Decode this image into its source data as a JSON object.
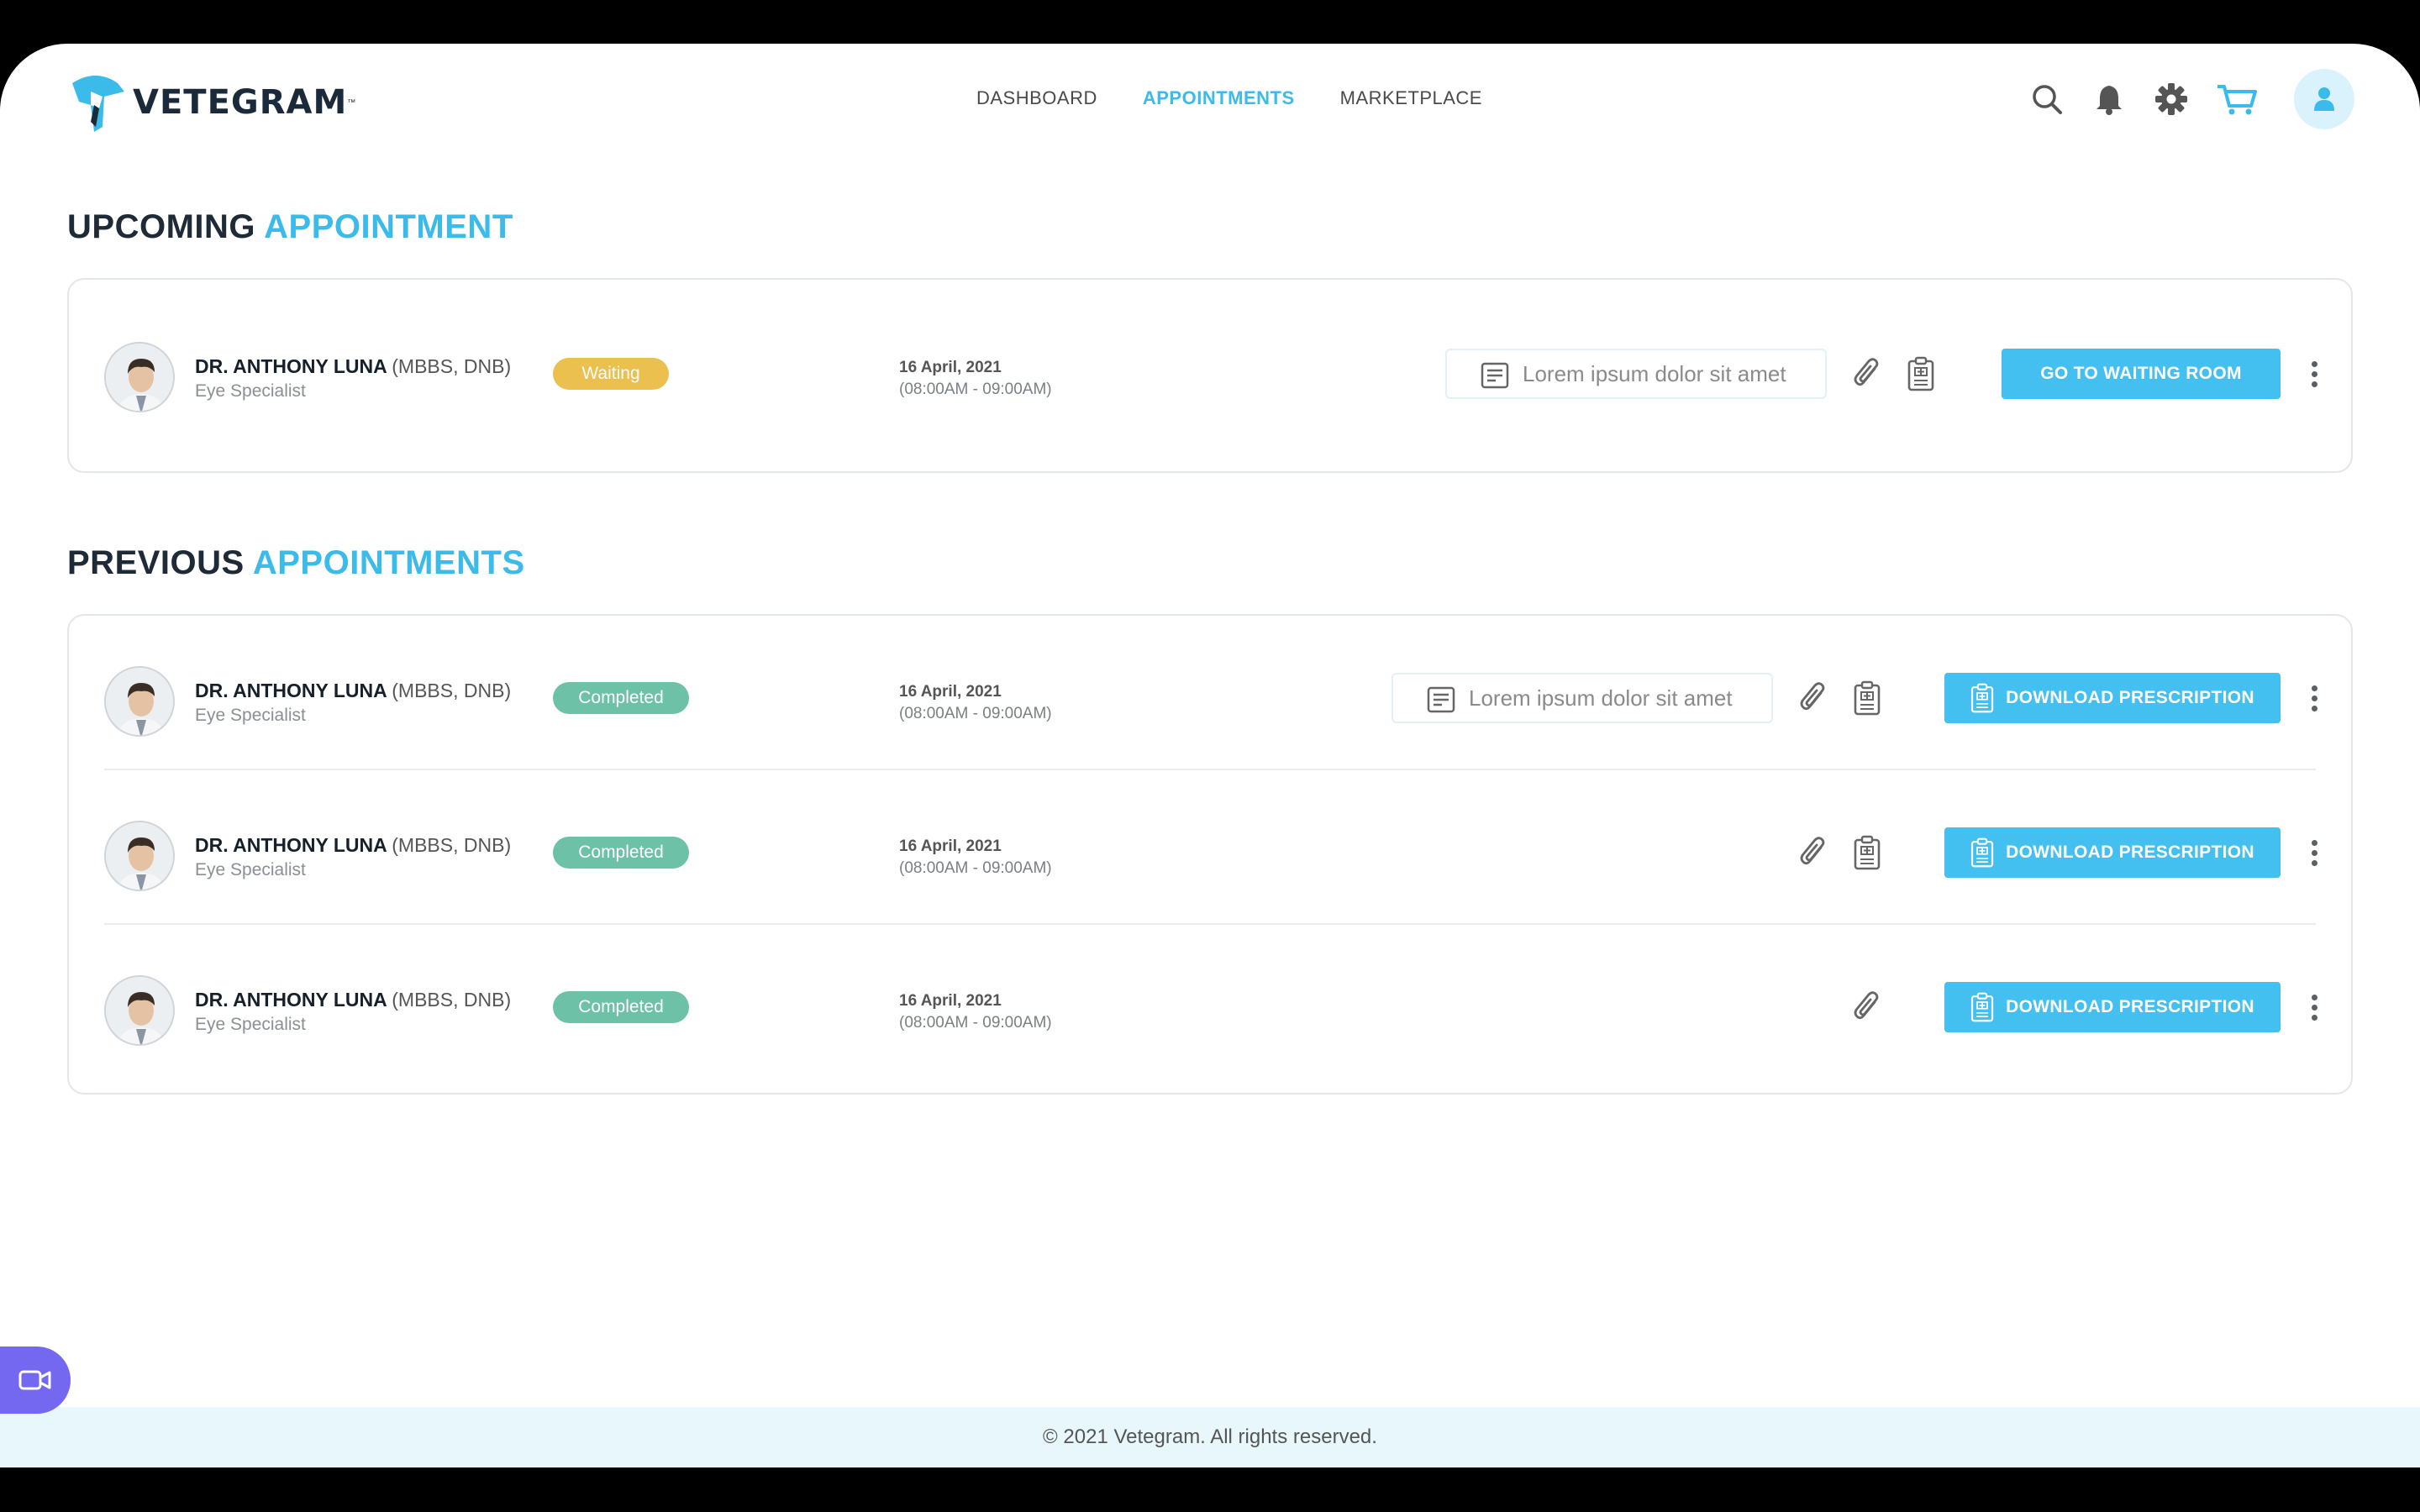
{
  "app": {
    "name": "VETEGRAM",
    "tm": "™"
  },
  "nav": [
    {
      "label": "DASHBOARD",
      "active": false
    },
    {
      "label": "APPOINTMENTS",
      "active": true
    },
    {
      "label": "MARKETPLACE",
      "active": false
    }
  ],
  "header_icons": [
    "search-icon",
    "bell-icon",
    "gear-icon",
    "cart-icon",
    "user-icon"
  ],
  "upcoming": {
    "title_plain": "UPCOMING ",
    "title_highlight": "APPOINTMENT",
    "items": [
      {
        "doctor": "DR. ANTHONY LUNA",
        "quals": "(MBBS, DNB)",
        "specialty": "Eye Specialist",
        "status": "Waiting",
        "date": "16 April, 2021",
        "time": "(08:00AM - 09:00AM)",
        "note": "Lorem ipsum dolor sit amet",
        "action": "GO TO WAITING ROOM"
      }
    ]
  },
  "previous": {
    "title_plain": "PREVIOUS ",
    "title_highlight": "APPOINTMENTS",
    "items": [
      {
        "doctor": "DR. ANTHONY LUNA",
        "quals": "(MBBS, DNB)",
        "specialty": "Eye Specialist",
        "status": "Completed",
        "date": "16 April, 2021",
        "time": "(08:00AM - 09:00AM)",
        "note": "Lorem ipsum dolor sit amet",
        "action": "DOWNLOAD PRESCRIPTION"
      },
      {
        "doctor": "DR. ANTHONY LUNA",
        "quals": "(MBBS, DNB)",
        "specialty": "Eye Specialist",
        "status": "Completed",
        "date": "16 April, 2021",
        "time": "(08:00AM - 09:00AM)",
        "action": "DOWNLOAD PRESCRIPTION"
      },
      {
        "doctor": "DR. ANTHONY LUNA",
        "quals": "(MBBS, DNB)",
        "specialty": "Eye Specialist",
        "status": "Completed",
        "date": "16 April, 2021",
        "time": "(08:00AM - 09:00AM)",
        "action": "DOWNLOAD PRESCRIPTION"
      }
    ]
  },
  "colors": {
    "accent": "#3bbbea",
    "waiting": "#ecc04f",
    "completed": "#6cc1a7",
    "fab": "#7467f0"
  },
  "footer": "© 2021 Vetegram. All rights reserved."
}
